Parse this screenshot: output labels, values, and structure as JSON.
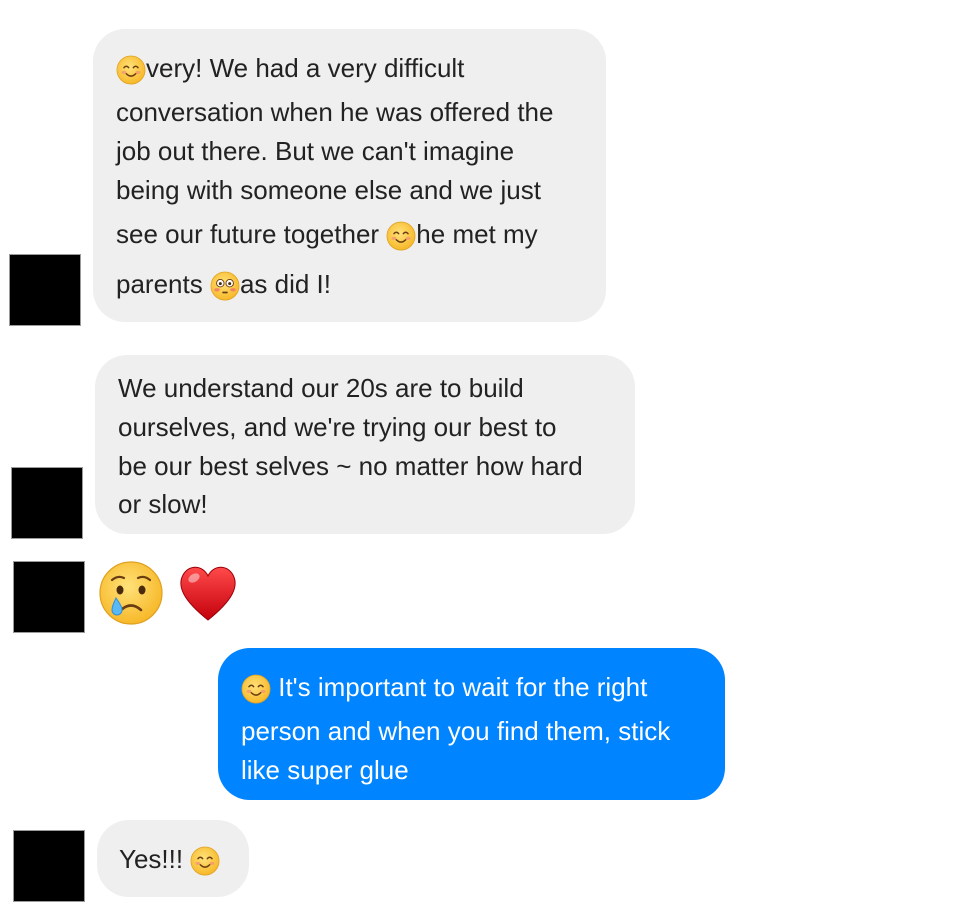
{
  "messages": [
    {
      "sender": "them",
      "lines": [
        [
          "",
          "very! We had a very difficult"
        ],
        [
          "conversation when he was offered the"
        ],
        [
          "job out there. But we can't imagine"
        ],
        [
          "being with someone else and we just"
        ],
        [
          "see our future together ",
          "he met my"
        ],
        [
          "parents ",
          "as did I!"
        ]
      ],
      "emoji": [
        "smiling-face-icon",
        "smiling-face-icon",
        "flushed-face-icon"
      ]
    },
    {
      "sender": "them",
      "lines": [
        [
          "We understand our 20s are to build"
        ],
        [
          "ourselves, and we're trying our best to"
        ],
        [
          "be our best selves ~ no matter how hard"
        ],
        [
          "or slow!"
        ]
      ]
    },
    {
      "sender": "them",
      "emoji": [
        "crying-face-icon",
        "red-heart-icon"
      ]
    },
    {
      "sender": "me",
      "lines": [
        [
          " It's important to wait for the right"
        ],
        [
          "person and when you find them, stick"
        ],
        [
          "like super glue"
        ]
      ],
      "emoji": [
        "smiling-face-icon"
      ]
    },
    {
      "sender": "them",
      "lines": [
        [
          "Yes!!! "
        ]
      ],
      "emoji": [
        "smiling-face-icon"
      ]
    }
  ],
  "colors": {
    "incoming_bubble": "#efefef",
    "outgoing_bubble": "#0084ff",
    "incoming_text": "#222222",
    "outgoing_text": "#ffffff",
    "avatar": "#000000"
  }
}
